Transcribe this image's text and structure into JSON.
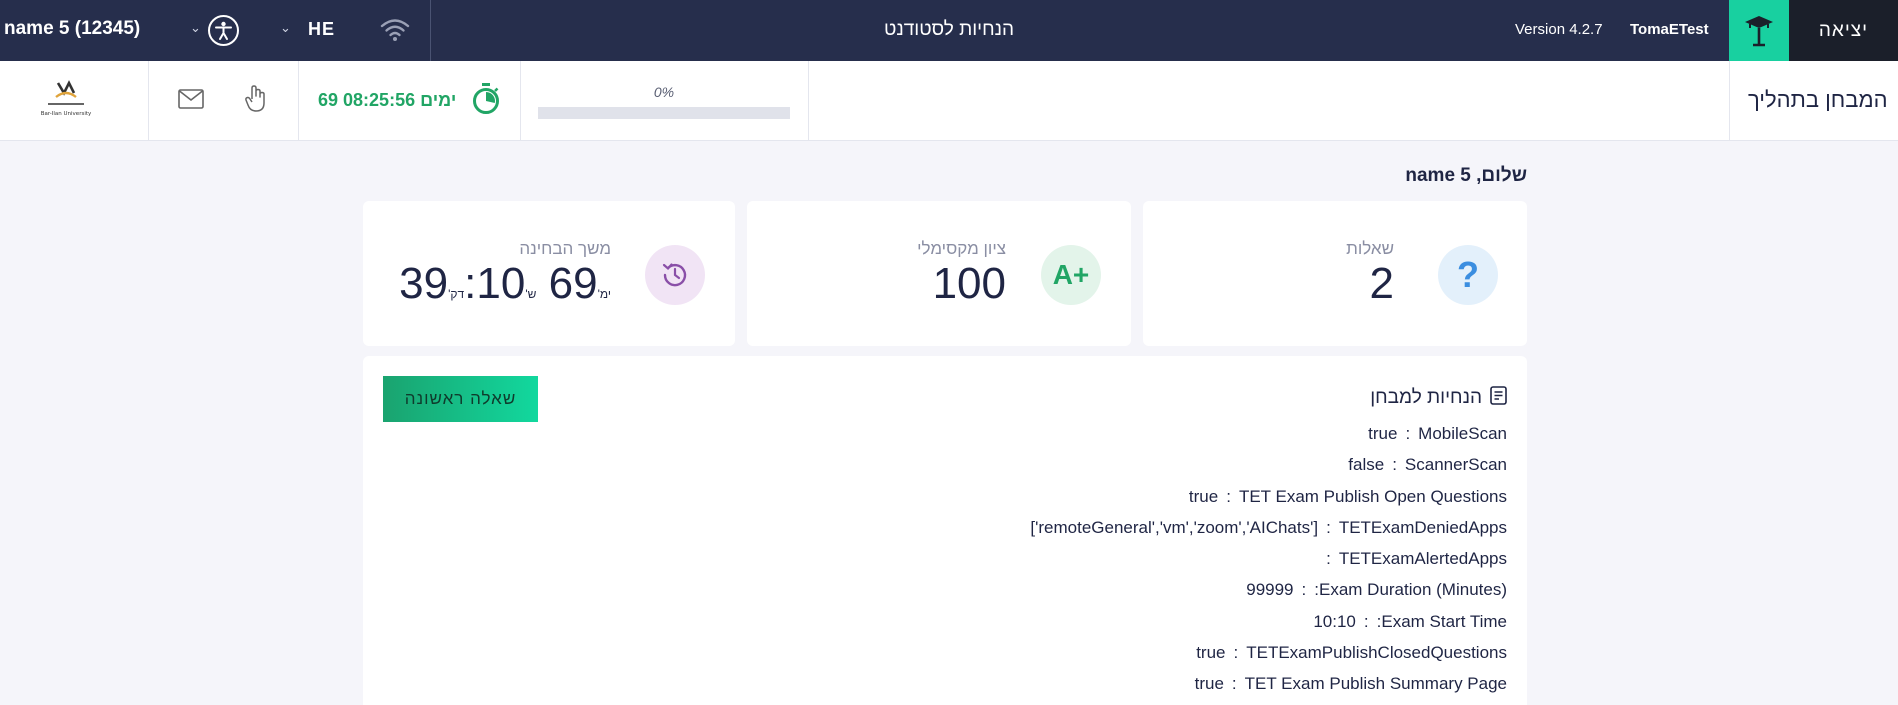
{
  "topbar": {
    "user": "name 5 (12345)",
    "language": "HE",
    "title": "הנחיות לסטודנט",
    "version": "Version 4.2.7",
    "tenant": "TomaETest",
    "exit_label": "יציאה"
  },
  "subbar": {
    "exam_status": "המבחן בתהליך",
    "progress_label": "0%",
    "progress_value": 0,
    "timer": "69 ימים 08:25:56",
    "university_logo_text": "Bar-Ilan University"
  },
  "greeting": "שלום, name 5",
  "stats": {
    "questions": {
      "label": "שאלות",
      "value": "2"
    },
    "max_grade": {
      "label": "ציון מקסימלי",
      "value": "100",
      "icon_text": "A+"
    },
    "duration": {
      "label": "משך הבחינה",
      "minutes": "39",
      "minutes_unit": "דק'",
      "hours": "10:",
      "hours_unit": "ש'",
      "days": "69",
      "days_unit": "ימ'"
    }
  },
  "instructions": {
    "title": "הנחיות למבחן",
    "first_question_button": "שאלה ראשונה",
    "rows": [
      {
        "key": "MobileScan",
        "value": "true"
      },
      {
        "key": "ScannerScan",
        "value": "false"
      },
      {
        "key": "TET Exam Publish Open Questions",
        "value": "true"
      },
      {
        "key": "TETExamDeniedApps",
        "value": "['remoteGeneral','vm','zoom','AIChats']"
      },
      {
        "key": "TETExamAlertedApps",
        "value": ""
      },
      {
        "key": "Exam Duration (Minutes):",
        "value": "99999"
      },
      {
        "key": "Exam Start Time:",
        "value": "10:10"
      },
      {
        "key": "TETExamPublishClosedQuestions",
        "value": "true"
      },
      {
        "key": "TET Exam Publish Summary Page",
        "value": "true"
      }
    ]
  },
  "colors": {
    "navy": "#262e4c",
    "accent": "#18d0a0",
    "timer_green": "#21a565"
  },
  "icons": [
    "accessibility-icon",
    "wifi-icon",
    "graduation-cap-icon",
    "mail-icon",
    "raise-hand-icon",
    "stopwatch-icon",
    "question-icon",
    "grade-icon",
    "history-icon",
    "document-icon",
    "chevron-down-icon"
  ]
}
